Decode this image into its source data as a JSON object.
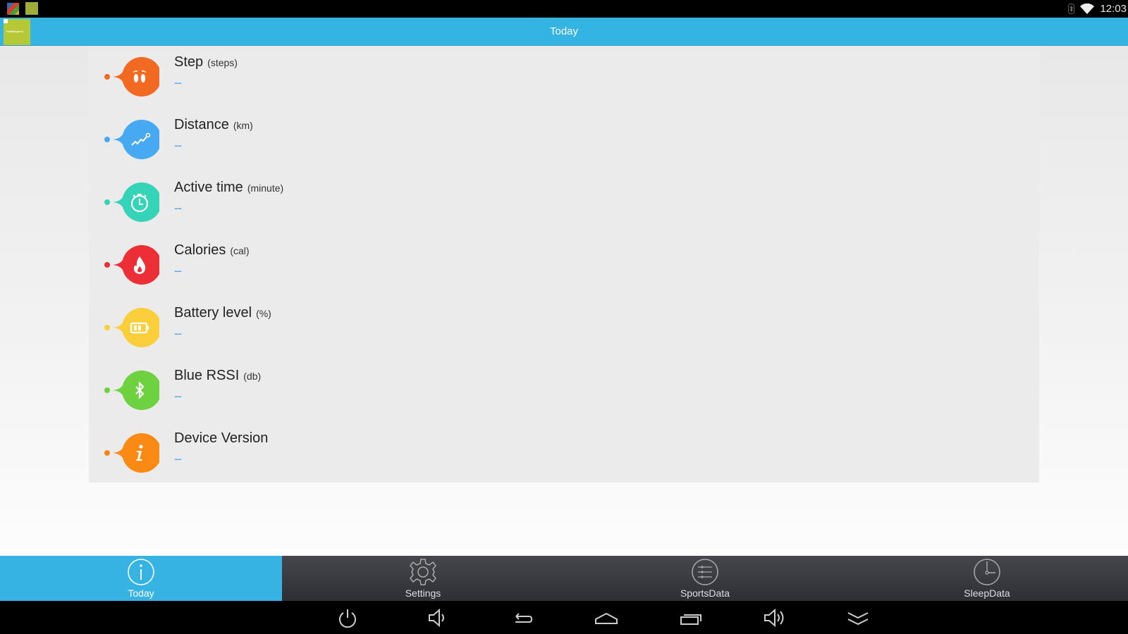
{
  "status_bar": {
    "time": "12:03",
    "icons": [
      "app-launcher-icon",
      "app-icon",
      "bluetooth-icon",
      "wifi-icon"
    ]
  },
  "action_bar": {
    "logo_text": "HANNspree",
    "title": "Today"
  },
  "metrics": [
    {
      "label": "Step",
      "unit": "(steps)",
      "value": "--",
      "icon": "footprints-icon",
      "color": "#f26a21"
    },
    {
      "label": "Distance",
      "unit": "(km)",
      "value": "--",
      "icon": "trend-line-icon",
      "color": "#46a9f2"
    },
    {
      "label": "Active time",
      "unit": "(minute)",
      "value": "--",
      "icon": "stopwatch-icon",
      "color": "#35d4b8"
    },
    {
      "label": "Calories",
      "unit": "(cal)",
      "value": "--",
      "icon": "flame-icon",
      "color": "#ec2f36"
    },
    {
      "label": "Battery level",
      "unit": "(%)",
      "value": "--",
      "icon": "battery-icon",
      "color": "#fbcf3c"
    },
    {
      "label": "Blue RSSI",
      "unit": "(db)",
      "value": "--",
      "icon": "bluetooth-icon",
      "color": "#6ed13f"
    },
    {
      "label": "Device Version",
      "unit": "",
      "value": "--",
      "icon": "info-icon",
      "color": "#fb8a14"
    }
  ],
  "tabs": [
    {
      "label": "Today",
      "icon": "info-circle-icon",
      "active": true
    },
    {
      "label": "Settings",
      "icon": "gear-icon",
      "active": false
    },
    {
      "label": "SportsData",
      "icon": "list-circle-icon",
      "active": false
    },
    {
      "label": "SleepData",
      "icon": "clock-circle-icon",
      "active": false
    }
  ],
  "nav_buttons": [
    "power-icon",
    "volume-down-icon",
    "back-icon",
    "home-icon",
    "recents-icon",
    "volume-up-icon",
    "hide-bar-icon"
  ],
  "colors": {
    "accent": "#33b4e2",
    "value_text": "#4aa6e6"
  }
}
